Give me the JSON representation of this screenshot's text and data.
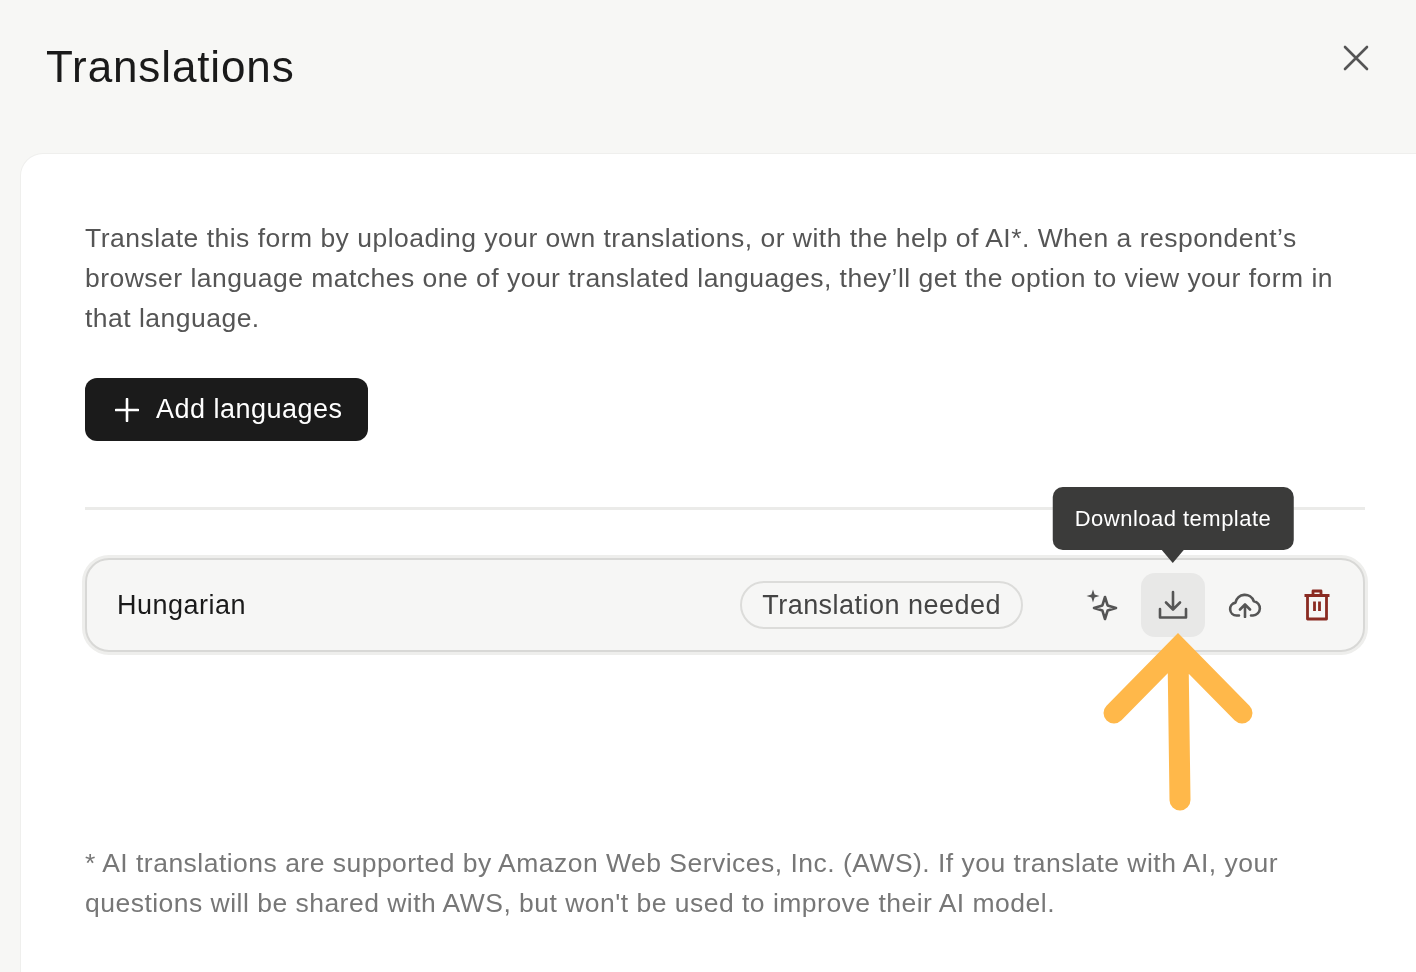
{
  "title": "Translations",
  "description": "Translate this form by uploading your own translations, or with the help of AI*. When a respondent’s browser language matches one of your translated languages, they’ll get the option to view your form in that language.",
  "add_button": {
    "label": "Add languages"
  },
  "languages": [
    {
      "name": "Hungarian",
      "status": "Translation needed",
      "actions": [
        {
          "kind": "ai_translate",
          "hovered": false,
          "annotated": false
        },
        {
          "kind": "download",
          "hovered": true,
          "tooltip": "Download template",
          "annotated": true
        },
        {
          "kind": "upload",
          "hovered": false,
          "annotated": false
        },
        {
          "kind": "delete",
          "hovered": false,
          "annotated": false
        }
      ]
    }
  ],
  "footnote": "* AI translations are supported by Amazon Web Services, Inc. (AWS). If you translate with AI, your questions will be shared with AWS, but won't be used to improve their AI model."
}
